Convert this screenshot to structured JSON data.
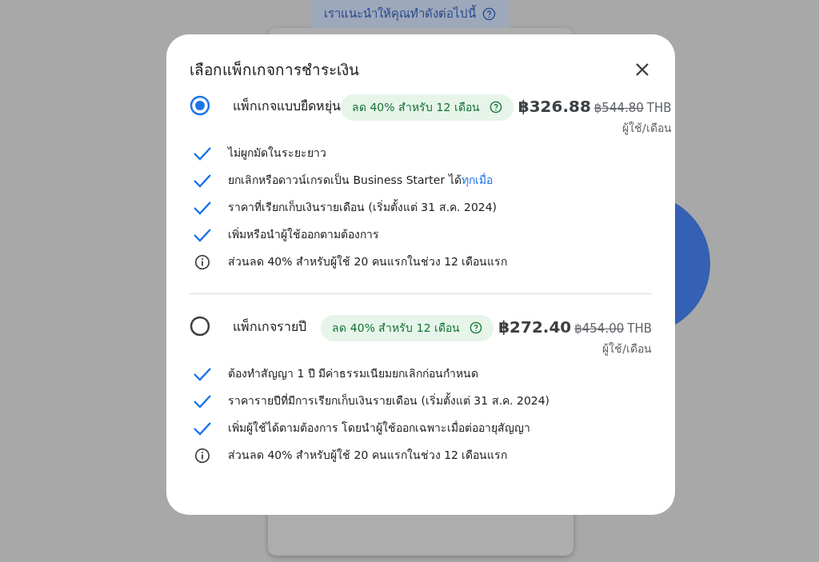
{
  "background": {
    "banner": "เราแนะนำให้คุณทำดังต่อไปนี้"
  },
  "dialog": {
    "title": "เลือกแพ็กเกจการชำระเงิน",
    "plans": [
      {
        "name": "แพ็กเกจแบบยืดหยุ่น",
        "selected": true,
        "discount": "ลด 40% สำหรับ 12 เดือน",
        "price": "฿326.88",
        "old_price": "฿544.80",
        "currency": "THB",
        "unit": "ผู้ใช้/เดือน",
        "features": [
          {
            "kind": "check",
            "text": "ไม่ผูกมัดในระยะยาว"
          },
          {
            "kind": "check",
            "text": "ยกเลิกหรือดาวน์เกรดเป็น Business Starter ได้",
            "link": "ทุกเมื่อ"
          },
          {
            "kind": "check",
            "text": "ราคาที่เรียกเก็บเงินรายเดือน (เริ่มตั้งแต่ 31 ส.ค. 2024)"
          },
          {
            "kind": "check",
            "text": "เพิ่มหรือนำผู้ใช้ออกตามต้องการ"
          },
          {
            "kind": "info",
            "text": "ส่วนลด 40% สำหรับผู้ใช้ 20 คนแรกในช่วง 12 เดือนแรก"
          }
        ]
      },
      {
        "name": "แพ็กเกจรายปี",
        "selected": false,
        "discount": "ลด 40% สำหรับ 12 เดือน",
        "price": "฿272.40",
        "old_price": "฿454.00",
        "currency": "THB",
        "unit": "ผู้ใช้/เดือน",
        "features": [
          {
            "kind": "check",
            "text": "ต้องทำสัญญา 1 ปี มีค่าธรรมเนียมยกเลิกก่อนกำหนด"
          },
          {
            "kind": "check",
            "text": "ราคารายปีที่มีการเรียกเก็บเงินรายเดือน (เริ่มตั้งแต่ 31 ส.ค. 2024)"
          },
          {
            "kind": "check",
            "text": "เพิ่มผู้ใช้ได้ตามต้องการ โดยนำผู้ใช้ออกเฉพาะเมื่อต่ออายุสัญญา"
          },
          {
            "kind": "info",
            "text": "ส่วนลด 40% สำหรับผู้ใช้ 20 คนแรกในช่วง 12 เดือนแรก"
          }
        ]
      }
    ]
  }
}
